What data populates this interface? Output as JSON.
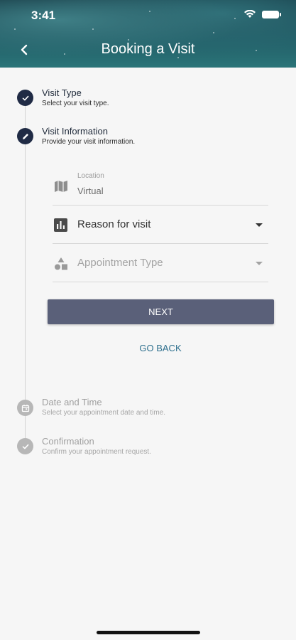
{
  "status_bar": {
    "time": "3:41"
  },
  "header": {
    "title": "Booking a Visit"
  },
  "steps": [
    {
      "title": "Visit Type",
      "subtitle": "Select your visit type.",
      "state": "completed",
      "icon": "check-icon"
    },
    {
      "title": "Visit Information",
      "subtitle": "Provide your visit information.",
      "state": "active",
      "icon": "pencil-icon"
    },
    {
      "title": "Date and Time",
      "subtitle": "Select your appointment date and time.",
      "state": "pending",
      "icon": "calendar-icon"
    },
    {
      "title": "Confirmation",
      "subtitle": "Confirm your appointment request.",
      "state": "pending",
      "icon": "check-icon"
    }
  ],
  "form": {
    "location": {
      "label": "Location",
      "value": "Virtual",
      "icon": "map-icon"
    },
    "reason": {
      "label": "Reason for visit",
      "icon": "bar-chart-icon"
    },
    "appointment_type": {
      "label": "Appointment Type",
      "icon": "shapes-icon"
    }
  },
  "buttons": {
    "next": "NEXT",
    "go_back": "GO BACK"
  },
  "colors": {
    "step_active": "#202b45",
    "step_pending": "#b7b7b7",
    "next_button": "#5a6079",
    "link": "#2d6f8d"
  }
}
